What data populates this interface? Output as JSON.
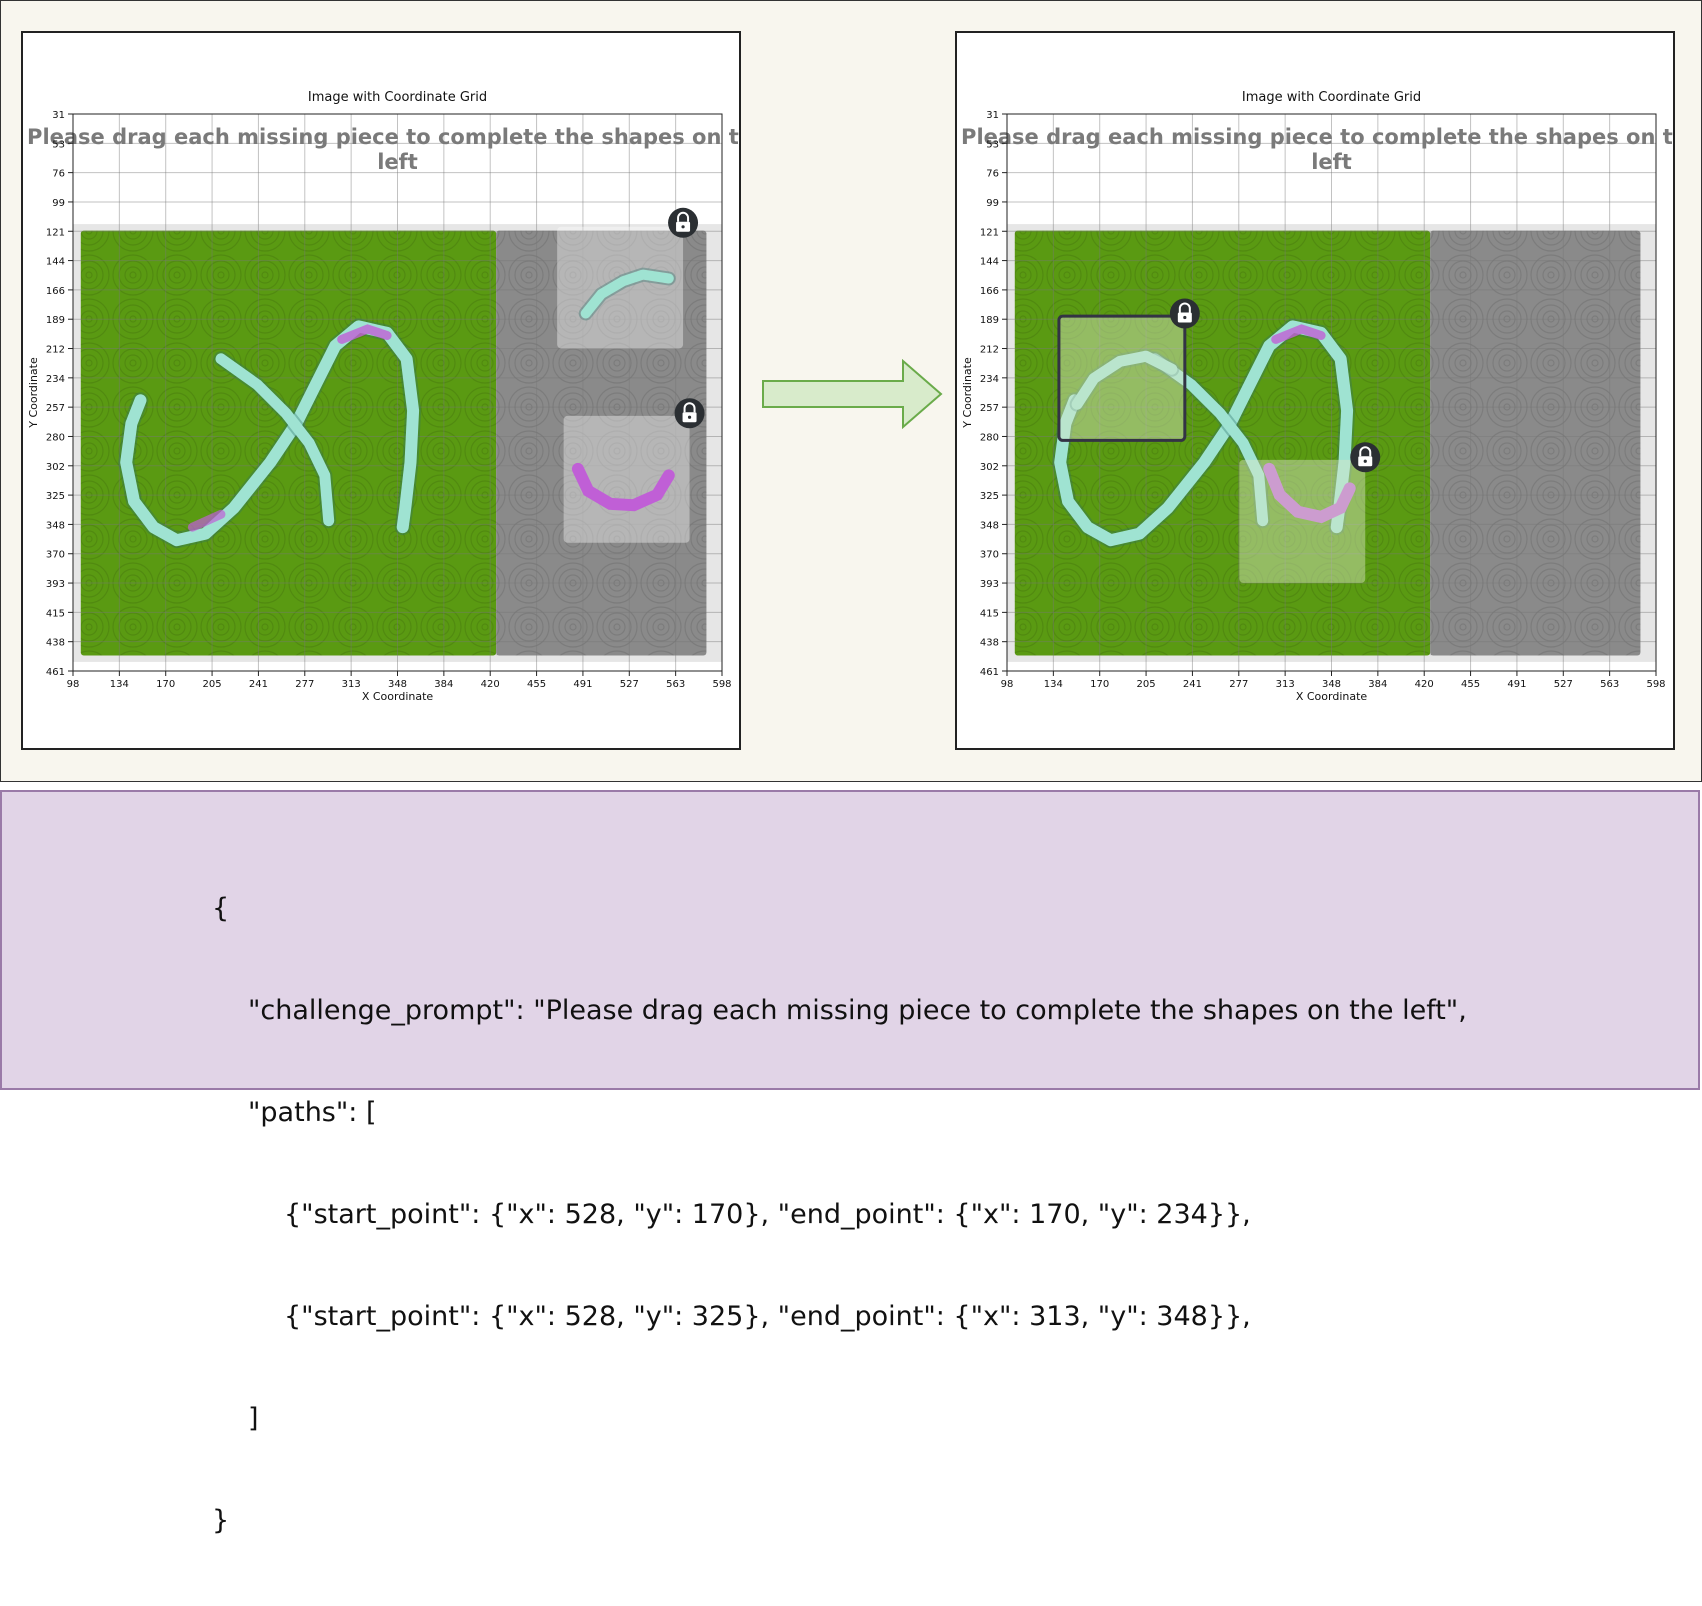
{
  "chart_title": "Image with Coordinate Grid",
  "xlabel": "X Coordinate",
  "ylabel": "Y Coordinate",
  "x_ticks": [
    "98",
    "134",
    "170",
    "205",
    "241",
    "277",
    "313",
    "348",
    "384",
    "420",
    "455",
    "491",
    "527",
    "563",
    "598"
  ],
  "y_ticks": [
    "31",
    "53",
    "76",
    "99",
    "121",
    "144",
    "166",
    "189",
    "212",
    "234",
    "257",
    "280",
    "302",
    "325",
    "348",
    "370",
    "393",
    "415",
    "438",
    "461"
  ],
  "challenge_prompt": "Please drag each missing piece to complete the shapes on the left",
  "colors": {
    "green_area": "#5a9a12",
    "gray_area": "#8a8a8a",
    "stroke_teal": "#9fe3d2",
    "stroke_purple": "#c05fd6",
    "arrow_fill": "#d8ebcb",
    "arrow_stroke": "#6aab4a"
  },
  "json_panel": {
    "line_open": "{",
    "line_prompt": "\"challenge_prompt\": \"Please drag each missing piece to complete the shapes on the left\",",
    "line_paths": "\"paths\": [",
    "line_path_1": "{\"start_point\": {\"x\": 528, \"y\": 170}, \"end_point\": {\"x\": 170, \"y\": 234}},",
    "line_path_2": "{\"start_point\": {\"x\": 528, \"y\": 325}, \"end_point\": {\"x\": 313, \"y\": 348}},",
    "line_bracket_close": "]",
    "line_close": "}"
  }
}
